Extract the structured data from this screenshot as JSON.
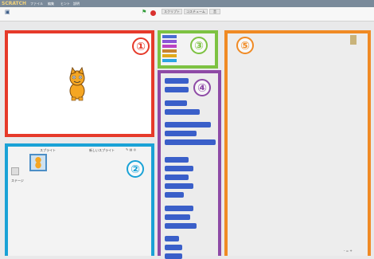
{
  "menubar": {
    "logo": "SCRATCH",
    "items": [
      "ファイル",
      "編集",
      "ヒント",
      "説明"
    ]
  },
  "tabs": [
    "スクリプト",
    "コスチューム",
    "音"
  ],
  "markers": [
    "①",
    "②",
    "③",
    "④",
    "⑤"
  ],
  "blocks": [
    "",
    "",
    "",
    "",
    "",
    "",
    "",
    "",
    "",
    "",
    "",
    "",
    "",
    "",
    "",
    "",
    "",
    "",
    ""
  ],
  "sprite_area": {
    "header_label": "スプライト",
    "new_sprite_label": "新しいスプライト",
    "stage_label": "ステージ"
  },
  "colors": {
    "stage": "#e63a2a",
    "sprite": "#1aa2d6",
    "palette": "#7dc242",
    "blocks": "#8e4aa6",
    "script": "#f08a24"
  }
}
